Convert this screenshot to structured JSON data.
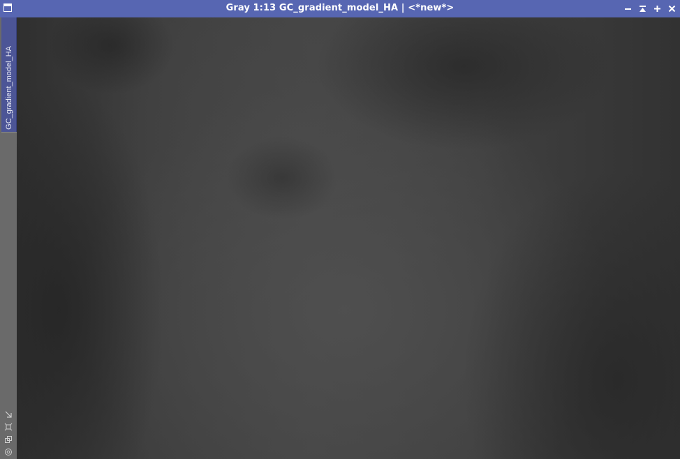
{
  "window": {
    "title": "Gray 1:13 GC_gradient_model_HA | <*new*>",
    "colors": {
      "titlebar": "#5766b2",
      "sidebar": "#6a6a6a",
      "tab": "#4c5596",
      "canvas": "#3a3a3a"
    }
  },
  "controls": [
    {
      "name": "minimize-icon"
    },
    {
      "name": "shade-icon"
    },
    {
      "name": "maximize-icon"
    },
    {
      "name": "close-icon"
    }
  ],
  "sidebar": {
    "tab_label": "GC_gradient_model_HA",
    "icons": [
      "resize-corner-icon",
      "fit-view-icon",
      "clone-icon",
      "target-icon"
    ]
  }
}
